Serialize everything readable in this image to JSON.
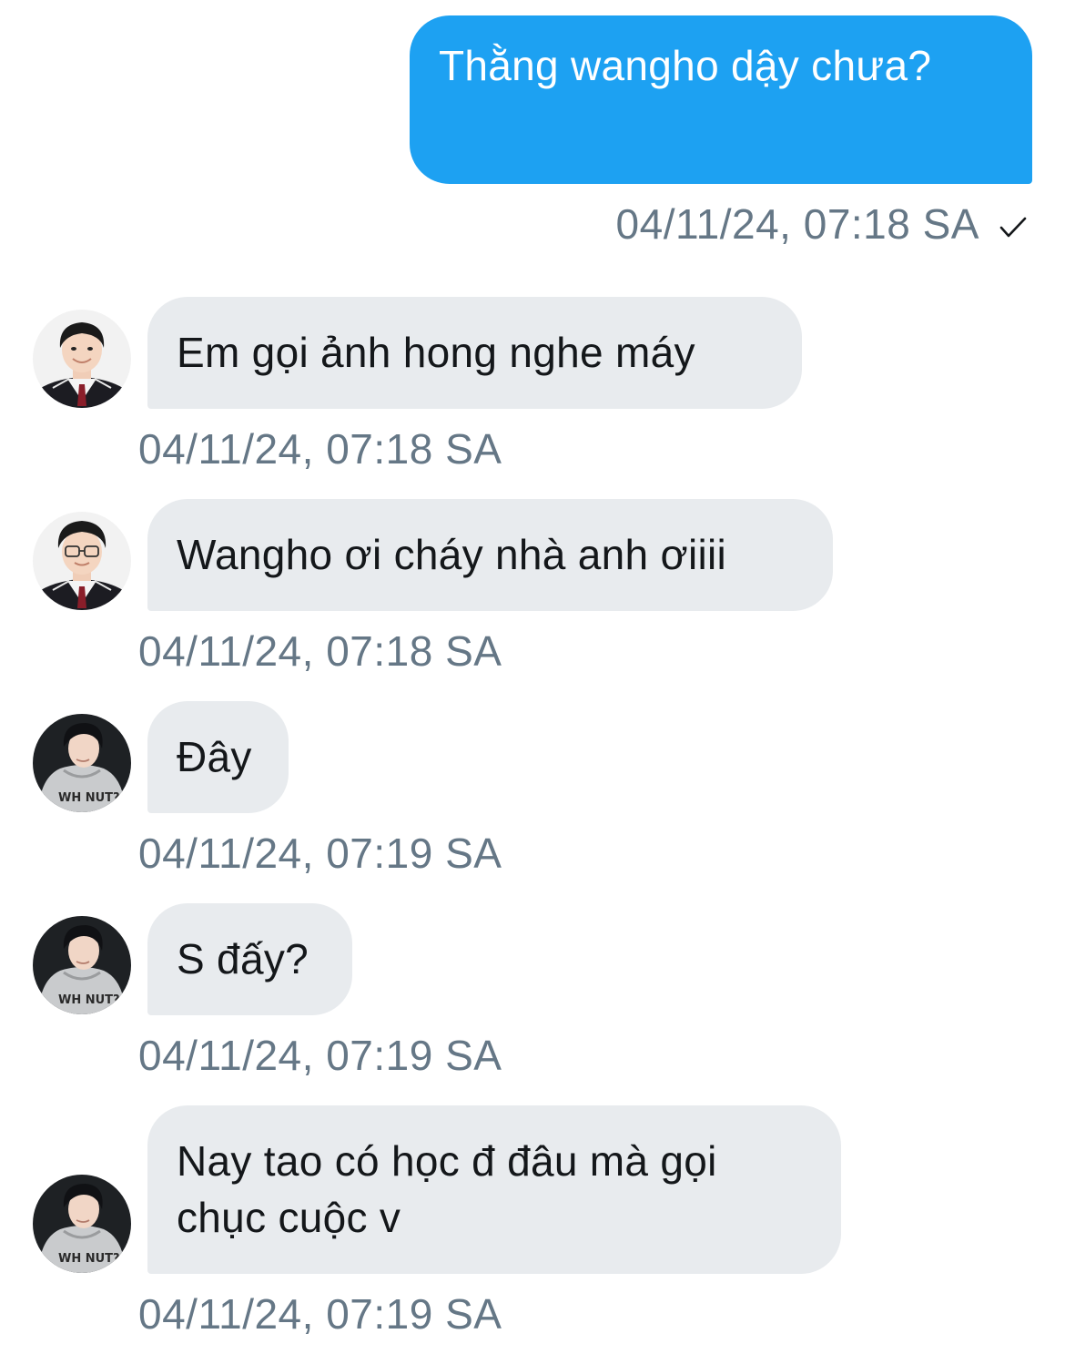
{
  "messages": [
    {
      "direction": "sent",
      "text": "Thằng wangho dậy chưa?",
      "time": "04/11/24, 07:18 SA",
      "status_icon": "checkmark-icon"
    },
    {
      "direction": "received",
      "text": "Em gọi ảnh hong nghe máy",
      "time": "04/11/24, 07:18 SA",
      "avatar": "avatar-boy-uniform-icon"
    },
    {
      "direction": "received",
      "text": "Wangho ơi cháy nhà anh ơiiii",
      "time": "04/11/24, 07:18 SA",
      "avatar": "avatar-boy-glasses-uniform-icon"
    },
    {
      "direction": "received",
      "text": "Đây",
      "time": "04/11/24, 07:19 SA",
      "avatar": "avatar-boy-hoodie-icon"
    },
    {
      "direction": "received",
      "text": "S đấy?",
      "time": "04/11/24, 07:19 SA",
      "avatar": "avatar-boy-hoodie-icon"
    },
    {
      "direction": "received",
      "text": "Nay tao có học đ đâu mà gọi chục cuộc v",
      "time": "04/11/24, 07:19 SA",
      "avatar": "avatar-boy-hoodie-icon"
    }
  ],
  "colors": {
    "sent_bubble": "#1da1f2",
    "received_bubble": "#e8ebee",
    "timestamp": "#657786",
    "text": "#14171a"
  }
}
